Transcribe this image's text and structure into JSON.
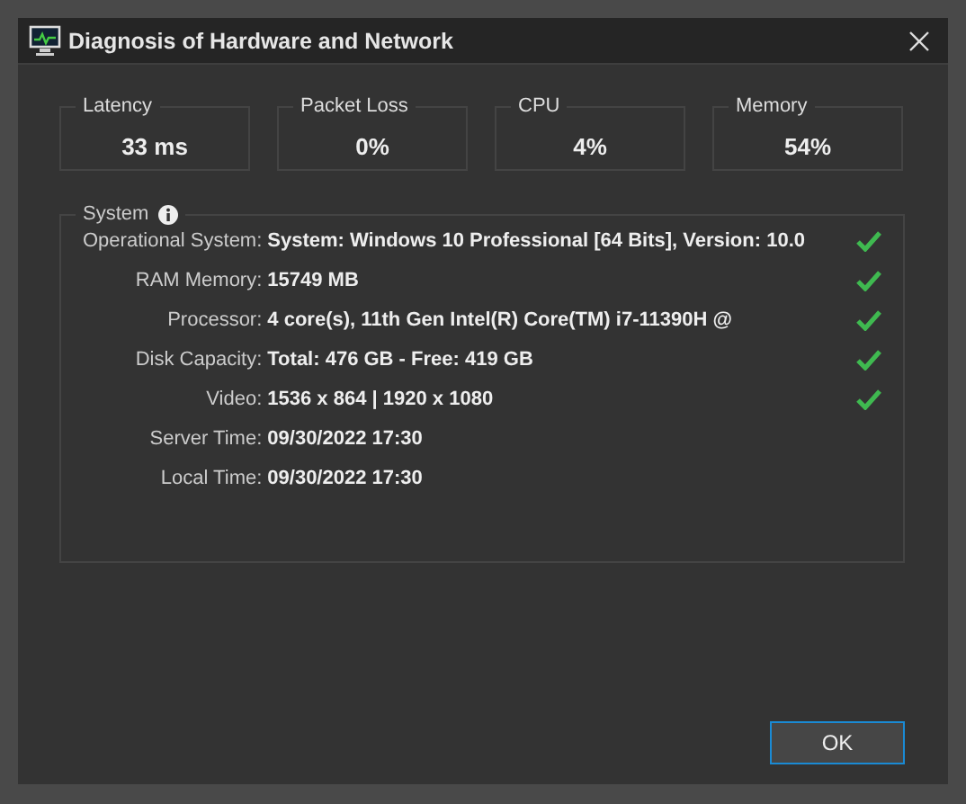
{
  "window": {
    "title": "Diagnosis of Hardware and Network"
  },
  "metrics": [
    {
      "label": "Latency",
      "value": "33 ms"
    },
    {
      "label": "Packet Loss",
      "value": "0%"
    },
    {
      "label": "CPU",
      "value": "4%"
    },
    {
      "label": "Memory",
      "value": "54%"
    }
  ],
  "system": {
    "title": "System",
    "rows": [
      {
        "label": "Operational System:",
        "value": "System: Windows 10 Professional [64 Bits], Version: 10.0",
        "verified": true
      },
      {
        "label": "RAM Memory:",
        "value": "15749 MB",
        "verified": true
      },
      {
        "label": "Processor:",
        "value": "4 core(s), 11th Gen Intel(R) Core(TM) i7-11390H @",
        "verified": true
      },
      {
        "label": "Disk Capacity:",
        "value": "Total: 476 GB - Free: 419 GB",
        "verified": true
      },
      {
        "label": "Video:",
        "value": "1536 x 864 | 1920 x 1080",
        "verified": true
      },
      {
        "label": "Server Time:",
        "value": "09/30/2022 17:30",
        "verified": false
      },
      {
        "label": "Local Time:",
        "value": "09/30/2022 17:30",
        "verified": false
      }
    ]
  },
  "buttons": [
    {
      "label": "OK"
    }
  ]
}
